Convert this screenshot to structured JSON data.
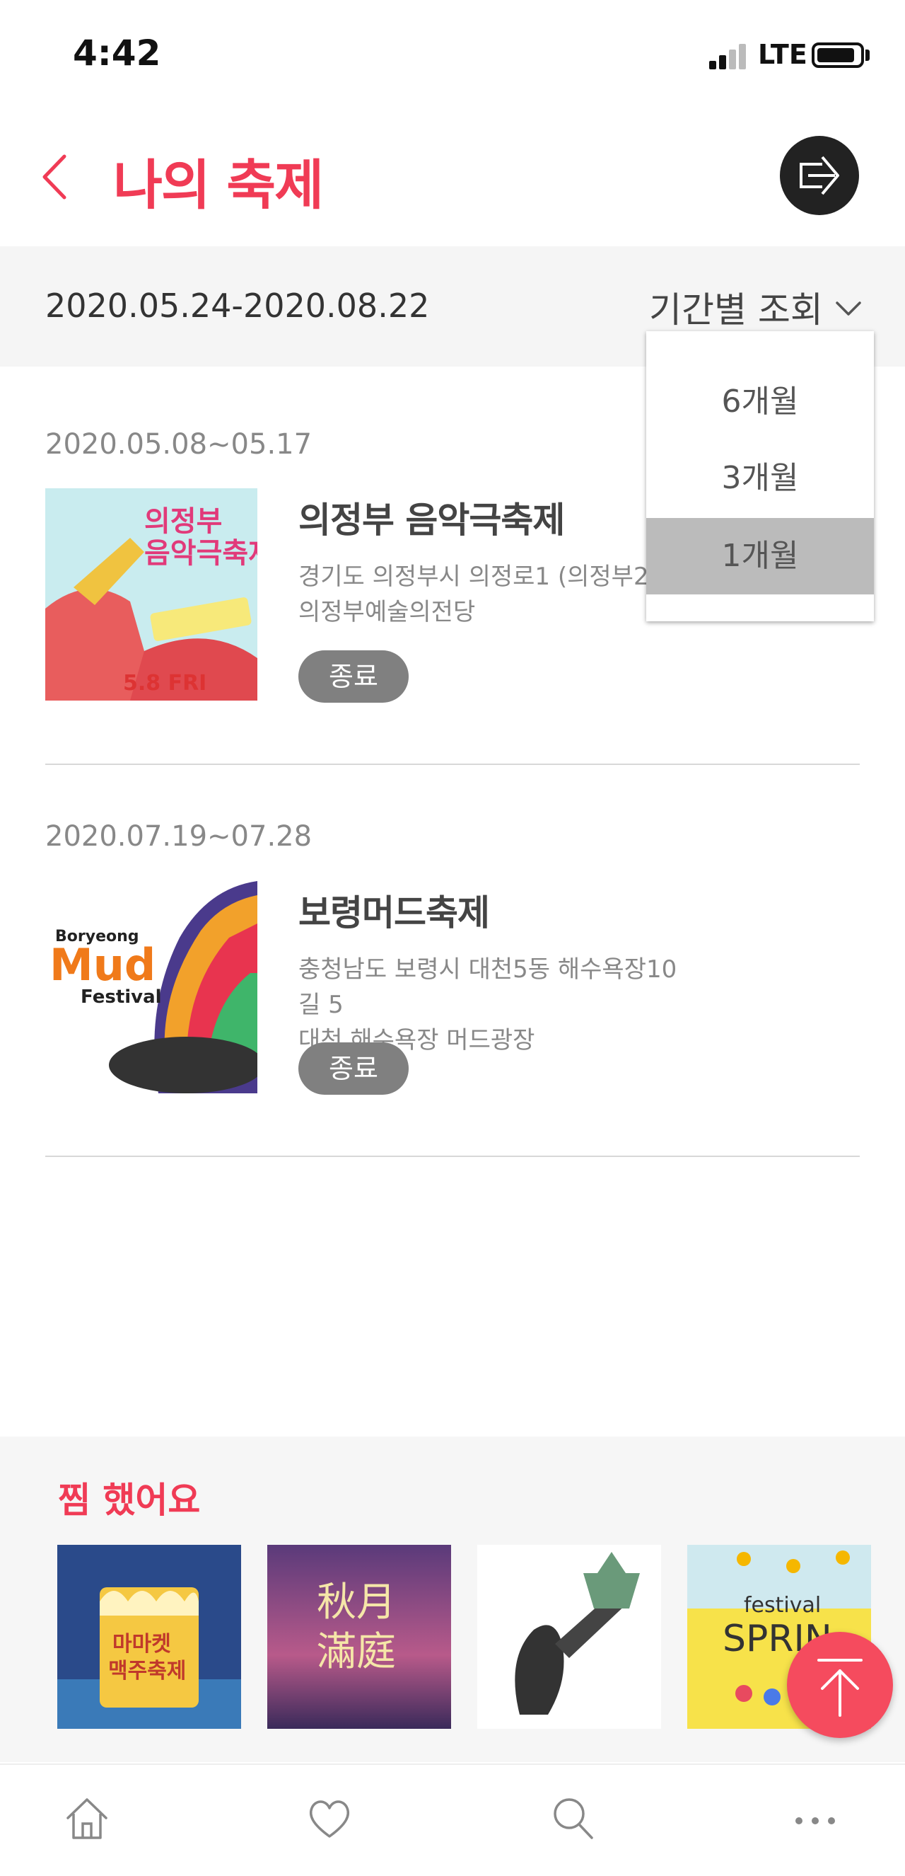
{
  "status_bar": {
    "time": "4:42",
    "network": "LTE"
  },
  "header": {
    "title": "나의 축제",
    "back_icon": "chevron-left-icon",
    "exit_icon": "exit-icon"
  },
  "period": {
    "range": "2020.05.24-2020.08.22",
    "label": "기간별 조회",
    "options": [
      "6개월",
      "3개월",
      "1개월"
    ],
    "selected": "1개월"
  },
  "festivals": [
    {
      "date": "2020.05.08~05.17",
      "name": "의정부 음악극축제",
      "address_line1": "경기도 의정부시 의정로1 (의정부2동",
      "address_line2": "의정부예술의전당",
      "status": "종료"
    },
    {
      "date": "2020.07.19~07.28",
      "name": "보령머드축제",
      "address_line1": "충청남도 보령시 대천5동 해수욕장10길 5",
      "address_line2": "대천 해수욕장 머드광장",
      "status": "종료"
    }
  ],
  "favorites": {
    "title": "찜 했어요"
  },
  "colors": {
    "accent": "#f03b55",
    "top_button": "#f54b5e",
    "status_pill": "#808080"
  },
  "bottom_nav": [
    "home-icon",
    "heart-icon",
    "search-icon",
    "more-icon"
  ]
}
